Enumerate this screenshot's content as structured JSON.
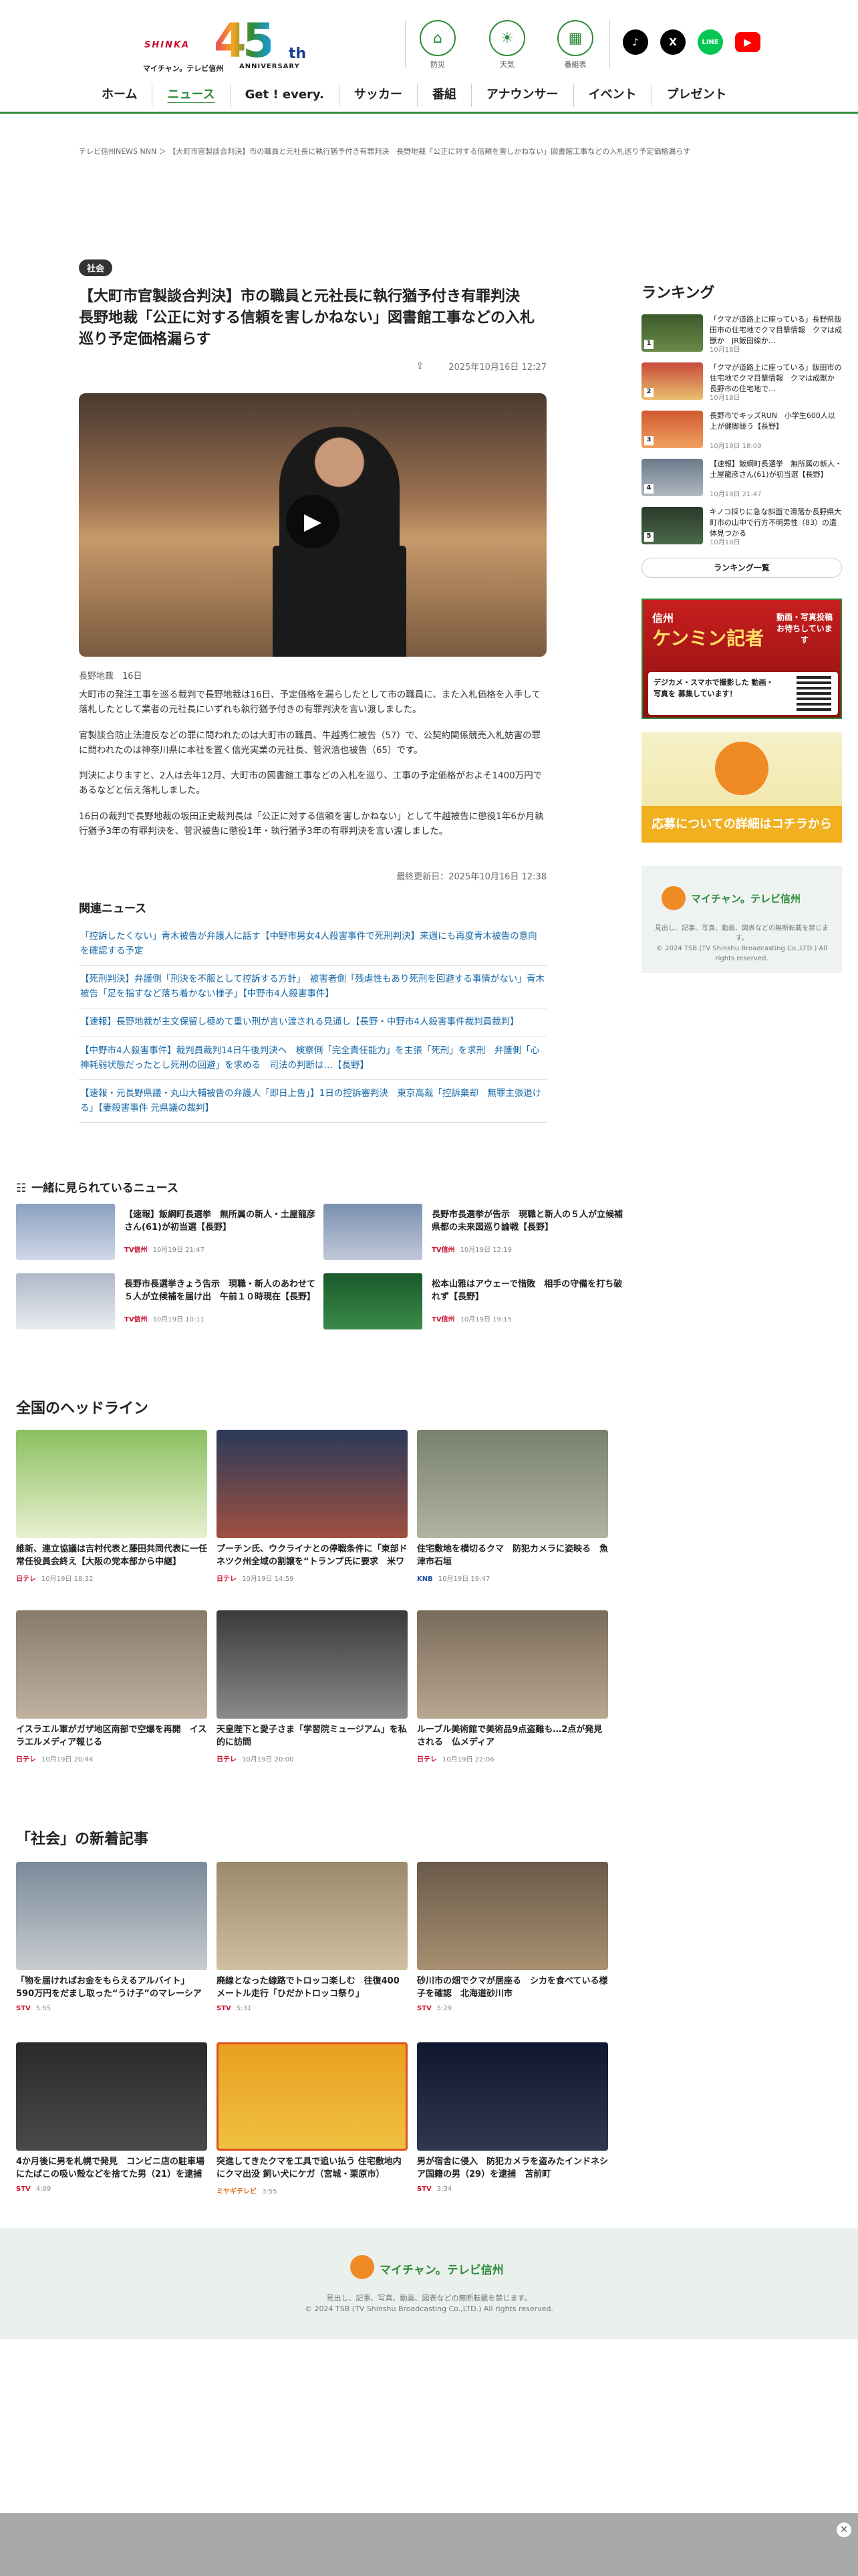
{
  "header": {
    "logo_brand": "SHINKA",
    "logo_number": "45",
    "logo_suffix": "th",
    "logo_name": "マイチャン。テレビ信州",
    "logo_anniversary": "ANNIVERSARY",
    "tools": [
      {
        "label": "防災",
        "icon": "disaster-icon"
      },
      {
        "label": "天気",
        "icon": "weather-icon"
      },
      {
        "label": "番組表",
        "icon": "schedule-icon"
      }
    ],
    "sns": [
      {
        "label": "♪",
        "name": "tiktok",
        "color": "#000000"
      },
      {
        "label": "X",
        "name": "x",
        "color": "#000000"
      },
      {
        "label": "LINE",
        "name": "line",
        "color": "#06c755"
      },
      {
        "label": "▶",
        "name": "youtube",
        "color": "#ff0000"
      }
    ]
  },
  "nav": [
    "ホーム",
    "ニュース",
    "Get ! every.",
    "サッカー",
    "番組",
    "アナウンサー",
    "イベント",
    "プレゼント"
  ],
  "breadcrumb": "テレビ信州NEWS NNN ＞ 【大町市官製談合判決】市の職員と元社長に執行猶予付き有罪判決　長野地裁「公正に対する信頼を害しかねない」図書館工事などの入札巡り予定価格漏らす",
  "article": {
    "category": "社会",
    "title": "【大町市官製談合判決】市の職員と元社長に執行猶予付き有罪判決　長野地裁「公正に対する信頼を害しかねない」図書館工事などの入札巡り予定価格漏らす",
    "date": "2025年10月16日 12:27",
    "byline": "長野地裁　16日",
    "paragraphs": [
      "大町市の発注工事を巡る裁判で長野地裁は16日、予定価格を漏らしたとして市の職員に、また入札価格を入手して落札したとして業者の元社長にいずれも執行猶予付きの有罪判決を言い渡しました。",
      "官製談合防止法違反などの罪に問われたのは大町市の職員、牛越秀仁被告（57）で、公契約関係競売入札妨害の罪に問われたのは神奈川県に本社を置く信光実業の元社長、菅沢浩也被告（65）です。",
      "判決によりますと、2人は去年12月、大町市の図書館工事などの入札を巡り、工事の予定価格がおよそ1400万円であるなどと伝え落札しました。",
      "16日の裁判で長野地裁の坂田正史裁判長は「公正に対する信頼を害しかねない」として牛越被告に懲役1年6か月執行猶予3年の有罪判決を、菅沢被告に懲役1年・執行猶予3年の有罪判決を言い渡しました。"
    ],
    "updated": "最終更新日：2025年10月16日 12:38"
  },
  "related": {
    "heading": "関連ニュース",
    "items": [
      "「控訴したくない」青木被告が弁護人に話す【中野市男女4人殺害事件で死刑判決】来週にも再度青木被告の意向を確認する予定",
      "【死刑判決】弁護側「刑決を不服として控訴する方針」　被害者側「残虐性もあり死刑を回避する事情がない」青木被告「足を指すなど落ち着かない様子」【中野市4人殺害事件】",
      "【速報】長野地裁が主文保留し極めて重い刑が言い渡される見通し【長野・中野市4人殺害事件裁判員裁判】",
      "【中野市4人殺害事件】裁判員裁判14日午後判決へ　検察側「完全責任能力」を主張「死刑」を求刑　弁護側「心神耗弱状態だったとし死刑の回避」を求める　司法の判断は…【長野】",
      "【速報・元長野県議・丸山大輔被告の弁護人「即日上告」】1日の控訴審判決　東京高裁「控訴棄却　無罪主張退ける」【妻殺害事件 元県議の裁判】"
    ]
  },
  "ranking": {
    "heading": "ランキング",
    "button": "ランキング一覧",
    "items": [
      {
        "no": "1",
        "text": "「クマが道路上に座っている」長野県飯田市の住宅地でクマ目撃情報　クマは成獣か　JR飯田線か…",
        "date": "10月18日"
      },
      {
        "no": "2",
        "text": "「クマが道路上に座っている」飯田市の住宅地でクマ目撃情報　クマは成獣か　長野市の住宅地で…",
        "date": "10月18日"
      },
      {
        "no": "3",
        "text": "長野市でキッズRUN　小学生600人以上が健脚競う【長野】",
        "date": "10月19日 18:09"
      },
      {
        "no": "4",
        "text": "【速報】飯綱町長選挙　無所属の新人・土屋龍彦さん(61)が初当選【長野】",
        "date": "10月19日 21:47"
      },
      {
        "no": "5",
        "text": "キノコ採りに急な斜面で滑落か長野県大町市の山中で行方不明男性（83）の遺体見つかる",
        "date": "10月18日"
      }
    ]
  },
  "sidebar_ad": {
    "brand": "信州",
    "title": "ケンミン記者",
    "tag": "動画・写真投稿お待ちしています",
    "desc": "デジカメ・スマホで撮影した 動画・写真を 募集しています！",
    "cta": "応募についての詳細はコチラから"
  },
  "sidebar_footer": {
    "name": "マイチャン。テレビ信州",
    "note": "見出し、記事、写真、動画、図表などの無断転載を禁じます。",
    "copy": "© 2024 TSB (TV Shinshu Broadcasting Co.,LTD.) All rights reserved."
  },
  "recommend": {
    "heading": "一緒に見られているニュース",
    "items": [
      {
        "text": "【速報】飯綱町長選挙　無所属の新人・土屋龍彦さん(61)が初当選【長野】",
        "source": "TV信州",
        "date": "10月19日 21:47"
      },
      {
        "text": "長野市長選挙が告示　現職と新人の５人が立候補　県都の未来図巡り論戦【長野】",
        "source": "TV信州",
        "date": "10月19日 12:19"
      },
      {
        "text": "長野市長選挙きょう告示　現職・新人のあわせて５人が立候補を届け出　午前１０時現在【長野】",
        "source": "TV信州",
        "date": "10月19日 10:11"
      },
      {
        "text": "松本山雅はアウェーで惜敗　相手の守備を打ち破れず【長野】",
        "source": "TV信州",
        "date": "10月19日 19:15"
      }
    ]
  },
  "national": {
    "heading": "全国のヘッドライン",
    "items": [
      {
        "text": "維新、連立協議は吉村代表と藤田共同代表に一任　常任役員会終え【大阪の党本部から中継】",
        "source": "日テレ",
        "date": "10月19日 18:32"
      },
      {
        "text": "プーチン氏、ウクライナとの停戦条件に「東部ドネツク州全域の割譲を“トランプ氏に要求　米ワシントンポスト報じる",
        "source": "日テレ",
        "date": "10月19日 14:59"
      },
      {
        "text": "住宅敷地を横切るクマ　防犯カメラに姿映る　魚津市石垣",
        "source": "KNB",
        "date": "10月19日 19:47"
      },
      {
        "text": "イスラエル軍がガザ地区南部で空爆を再開　イスラエルメディア報じる",
        "source": "日テレ",
        "date": "10月19日 20:44"
      },
      {
        "text": "天皇陛下と愛子さま「学習院ミュージアム」を私的に訪問",
        "source": "日テレ",
        "date": "10月19日 20:00"
      },
      {
        "text": "ルーブル美術館で美術品9点盗難も…2点が発見される　仏メディア",
        "source": "日テレ",
        "date": "10月19日 22:06"
      }
    ]
  },
  "society": {
    "heading": "「社会」の新着記事",
    "items": [
      {
        "text": "「物を届ければお金をもらえるアルバイト」590万円をだまし取った“うけ子”のマレーシア国籍の男（39）を逮捕　亜…",
        "source": "STV",
        "date": "5:55"
      },
      {
        "text": "廃線となった線路でトロッコ楽しむ　往復400メートル走行「ひだかトロッコ祭り」",
        "source": "STV",
        "date": "5:31"
      },
      {
        "text": "砂川市の畑でクマが居座る　シカを食べている様子を確認　北海道砂川市",
        "source": "STV",
        "date": "5:29"
      },
      {
        "text": "4か月後に男を札幌で発見　コンビニ店の駐車場にたばこの吸い殻などを捨てた男（21）を逮捕　滝川市",
        "source": "STV",
        "date": "4:09"
      },
      {
        "text": "突進してきたクマを工具で追い払う 住宅敷地内にクマ出没 飼い犬にケガ（宮城・栗原市）",
        "source": "ミヤギテレビ",
        "date": "3:55"
      },
      {
        "text": "男が宿舎に侵入　防犯カメラを盗みたインドネシア国籍の男（29）を逮捕　苫前町",
        "source": "STV",
        "date": "3:34"
      }
    ]
  },
  "footer": {
    "name": "マイチャン。テレビ信州",
    "note": "見出し、記事、写真、動画、図表などの無断転載を禁じます。",
    "copy": "© 2024 TSB (TV Shinshu Broadcasting Co.,LTD.) All rights reserved."
  },
  "colors": {
    "brand_green": "#2e8b3a",
    "brand_red": "#c8102e",
    "link_blue": "#1668a8"
  }
}
